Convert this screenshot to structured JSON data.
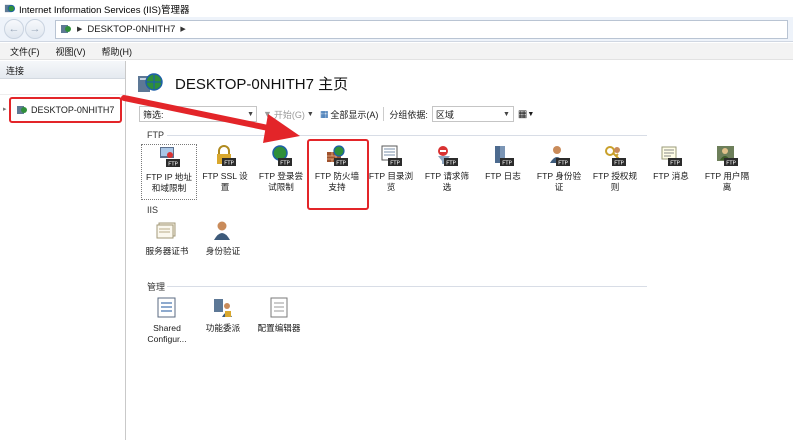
{
  "window": {
    "title": "Internet Information Services (IIS)管理器"
  },
  "address": {
    "server": "DESKTOP-0NHITH7"
  },
  "menu": {
    "items": [
      "文件(F)",
      "视图(V)",
      "帮助(H)"
    ]
  },
  "connections": {
    "header": "连接",
    "node_label": "DESKTOP-0NHITH7"
  },
  "page": {
    "title": "DESKTOP-0NHITH7 主页"
  },
  "filter": {
    "label": "筛选:",
    "start_label": "开始(G)",
    "show_all_label": "全部显示(A)",
    "group_label": "分组依据:",
    "group_value": "区域"
  },
  "sections": {
    "ftp": "FTP",
    "iis": "IIS",
    "manage": "管理"
  },
  "ftp_features": [
    {
      "line1": "FTP IP 地址",
      "line2": "和域限制",
      "icon": "ftp-ip-restrictions-icon"
    },
    {
      "line1": "FTP SSL 设",
      "line2": "置",
      "icon": "ftp-ssl-lock-icon"
    },
    {
      "line1": "FTP 登录尝",
      "line2": "试限制",
      "icon": "ftp-logon-attempt-icon"
    },
    {
      "line1": "FTP 防火墙",
      "line2": "支持",
      "icon": "ftp-firewall-icon"
    },
    {
      "line1": "FTP 目录浏",
      "line2": "览",
      "icon": "ftp-directory-browsing-icon"
    },
    {
      "line1": "FTP 请求筛",
      "line2": "选",
      "icon": "ftp-request-filtering-icon"
    },
    {
      "line1": "FTP 日志",
      "line2": "",
      "icon": "ftp-logging-icon"
    },
    {
      "line1": "FTP 身份验",
      "line2": "证",
      "icon": "ftp-authentication-icon"
    },
    {
      "line1": "FTP 授权规",
      "line2": "则",
      "icon": "ftp-authorization-icon"
    },
    {
      "line1": "FTP 消息",
      "line2": "",
      "icon": "ftp-messages-icon"
    },
    {
      "line1": "FTP 用户隔",
      "line2": "离",
      "icon": "ftp-user-isolation-icon"
    }
  ],
  "iis_features": [
    {
      "line1": "服务器证书",
      "line2": "",
      "icon": "server-certificates-icon"
    },
    {
      "line1": "身份验证",
      "line2": "",
      "icon": "authentication-icon"
    }
  ],
  "manage_features": [
    {
      "line1": "Shared",
      "line2": "Configur...",
      "icon": "shared-configuration-icon"
    },
    {
      "line1": "功能委派",
      "line2": "",
      "icon": "feature-delegation-icon"
    },
    {
      "line1": "配置编辑器",
      "line2": "",
      "icon": "configuration-editor-icon"
    }
  ],
  "colors": {
    "highlight": "#e32529",
    "ftp_badge": "#2b2b2b",
    "accent": "#1e5fa8"
  }
}
